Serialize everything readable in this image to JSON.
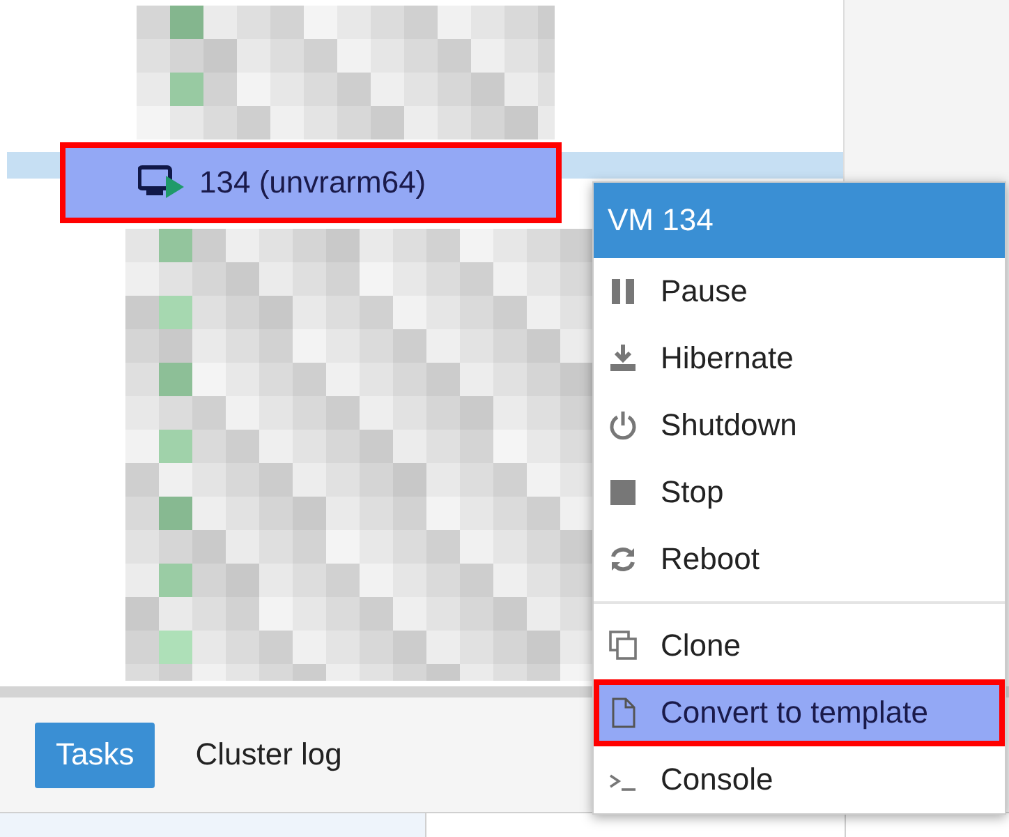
{
  "tree": {
    "item": {
      "label": "134 (unvrarm64)",
      "selected": true,
      "annotated": true
    }
  },
  "context_menu": {
    "title": "VM 134",
    "items": [
      {
        "kind": "item",
        "label": "Pause",
        "annotated": false
      },
      {
        "kind": "item",
        "label": "Hibernate",
        "annotated": false
      },
      {
        "kind": "item",
        "label": "Shutdown",
        "annotated": false
      },
      {
        "kind": "item",
        "label": "Stop",
        "annotated": false
      },
      {
        "kind": "item",
        "label": "Reboot",
        "annotated": false
      },
      {
        "kind": "separator"
      },
      {
        "kind": "item",
        "label": "Clone",
        "annotated": false
      },
      {
        "kind": "item",
        "label": "Convert to template",
        "annotated": true
      },
      {
        "kind": "item",
        "label": "Console",
        "annotated": false
      }
    ]
  },
  "bottom_panel": {
    "tabs": [
      {
        "label": "Tasks",
        "selected": true
      },
      {
        "label": "Cluster log",
        "selected": false
      }
    ]
  }
}
